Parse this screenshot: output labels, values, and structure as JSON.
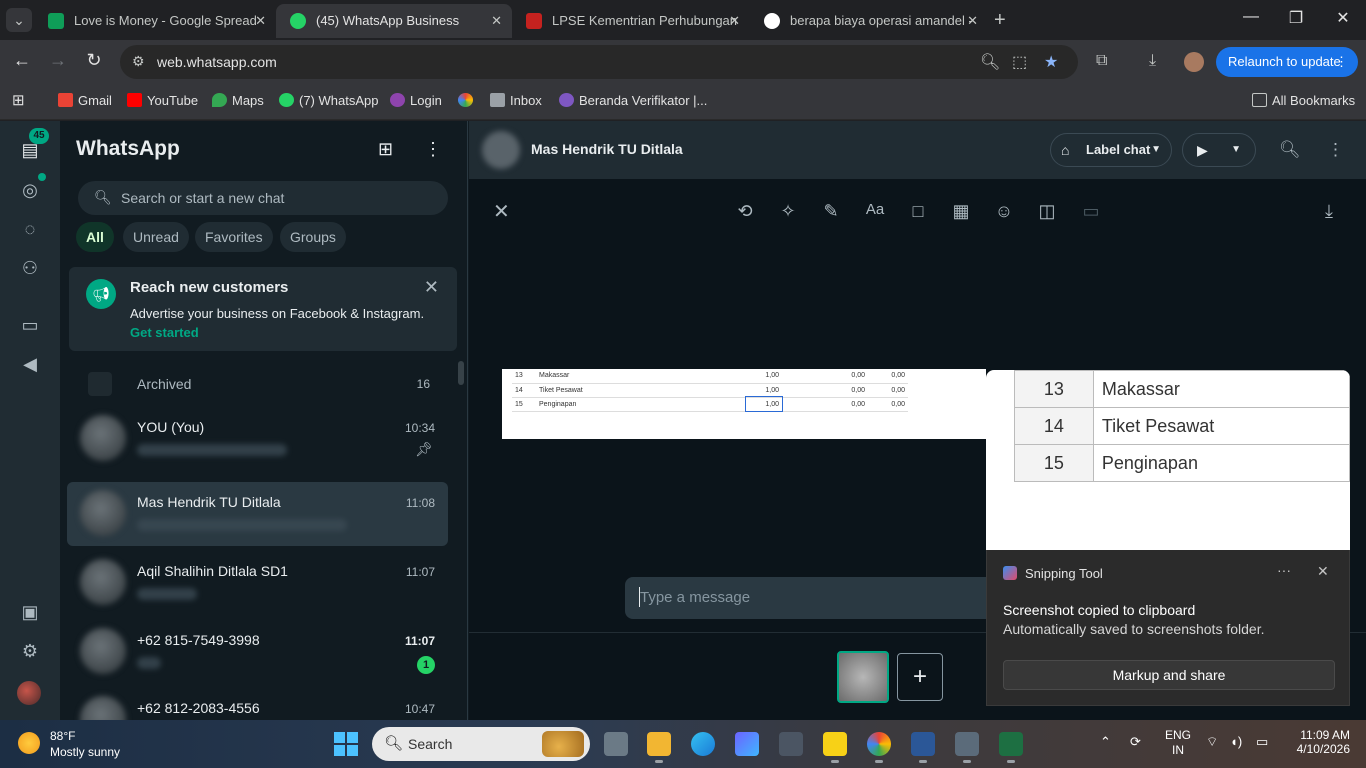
{
  "browser": {
    "tabs": [
      {
        "title": "Love is Money - Google Spread",
        "color": "#0f9d58"
      },
      {
        "title": "(45) WhatsApp Business",
        "color": "#25d366"
      },
      {
        "title": "LPSE Kementrian Perhubungan",
        "color": "#c5221f"
      },
      {
        "title": "berapa biaya operasi amandel -",
        "color": "#ffffff"
      }
    ],
    "url": "web.whatsapp.com",
    "relaunch_label": "Relaunch to update",
    "bookmarks": [
      {
        "label": "Gmail",
        "color": "#ea4335"
      },
      {
        "label": "YouTube",
        "color": "#ff0000"
      },
      {
        "label": "Maps",
        "color": "#34a853"
      },
      {
        "label": "(7) WhatsApp",
        "color": "#25d366"
      },
      {
        "label": "Login",
        "color": "#8e44ad"
      },
      {
        "label": "",
        "color": "#fbbc04"
      },
      {
        "label": "Inbox",
        "color": "#9aa0a6"
      },
      {
        "label": "Beranda Verifikator |...",
        "color": "#7e57c2"
      }
    ],
    "all_bookmarks": "All Bookmarks"
  },
  "rail": {
    "badge": "45"
  },
  "sidebar": {
    "title": "WhatsApp",
    "search_placeholder": "Search or start a new chat",
    "filters": [
      "All",
      "Unread",
      "Favorites",
      "Groups"
    ],
    "promo": {
      "title": "Reach new customers",
      "body": "Advertise your business on Facebook & Instagram.",
      "link": "Get started"
    },
    "archived": {
      "label": "Archived",
      "count": "16"
    },
    "chats": [
      {
        "name": "YOU (You)",
        "time": "10:34",
        "pinned": true,
        "unread": ""
      },
      {
        "name": "Mas Hendrik TU Ditlala",
        "time": "11:08",
        "pinned": false,
        "unread": ""
      },
      {
        "name": "Aqil Shalihin Ditlala SD1",
        "time": "11:07",
        "pinned": false,
        "unread": ""
      },
      {
        "name": "+62 815-7549-3998",
        "time": "11:07",
        "pinned": false,
        "unread": "1"
      },
      {
        "name": "+62 812-2083-4556",
        "time": "10:47",
        "pinned": false,
        "unread": ""
      }
    ]
  },
  "conversation": {
    "name": "Mas Hendrik TU Ditlala",
    "label_chat": "Label chat",
    "message_placeholder": "Type a message",
    "preview_rows": [
      {
        "no": "13",
        "item": "Makassar",
        "qty": "1,00",
        "a": "0,00",
        "b": "0,00"
      },
      {
        "no": "14",
        "item": "Tiket Pesawat",
        "qty": "1,00",
        "a": "0,00",
        "b": "0,00"
      },
      {
        "no": "15",
        "item": "Penginapan",
        "qty": "1,00",
        "a": "0,00",
        "b": "0,00"
      }
    ]
  },
  "snip": {
    "rows": [
      {
        "no": "13",
        "item": "Makassar"
      },
      {
        "no": "14",
        "item": "Tiket Pesawat"
      },
      {
        "no": "15",
        "item": "Penginapan"
      }
    ],
    "app": "Snipping Tool",
    "heading": "Screenshot copied to clipboard",
    "body": "Automatically saved to screenshots folder.",
    "button": "Markup and share"
  },
  "taskbar": {
    "temp": "88°F",
    "weather": "Mostly sunny",
    "search": "Search",
    "lang1": "ENG",
    "lang2": "IN",
    "time": "11:09 AM",
    "date": "4/10/2026"
  }
}
